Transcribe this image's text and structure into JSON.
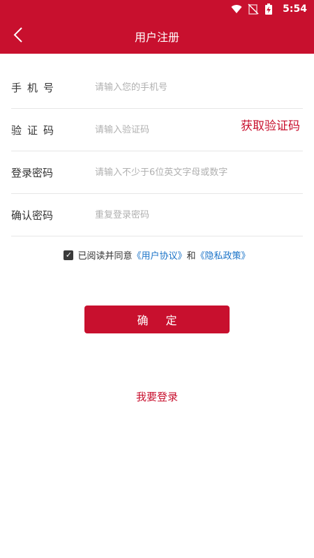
{
  "status_bar": {
    "time": "5:54",
    "icons": [
      "wifi-icon",
      "no-signal-icon",
      "battery-charging-icon"
    ]
  },
  "header": {
    "title": "用户注册",
    "back_icon": "chevron-left-icon"
  },
  "colors": {
    "brand": "#c8102e",
    "link": "#1a73c8"
  },
  "form": {
    "phone": {
      "label": "手机号",
      "placeholder": "请输入您的手机号",
      "value": ""
    },
    "code": {
      "label": "验证码",
      "placeholder": "请输入验证码",
      "value": "",
      "get_code_label": "获取验证码"
    },
    "password": {
      "label": "登录密码",
      "placeholder": "请输入不少于6位英文字母或数字",
      "value": ""
    },
    "confirm_password": {
      "label": "确认密码",
      "placeholder": "重复登录密码",
      "value": ""
    }
  },
  "agreement": {
    "checked": true,
    "prefix": "已阅读并同意",
    "user_agreement": "《用户协议》",
    "conjunction": "和",
    "privacy_policy": "《隐私政策》"
  },
  "actions": {
    "confirm_label": "确 定",
    "login_label": "我要登录"
  }
}
